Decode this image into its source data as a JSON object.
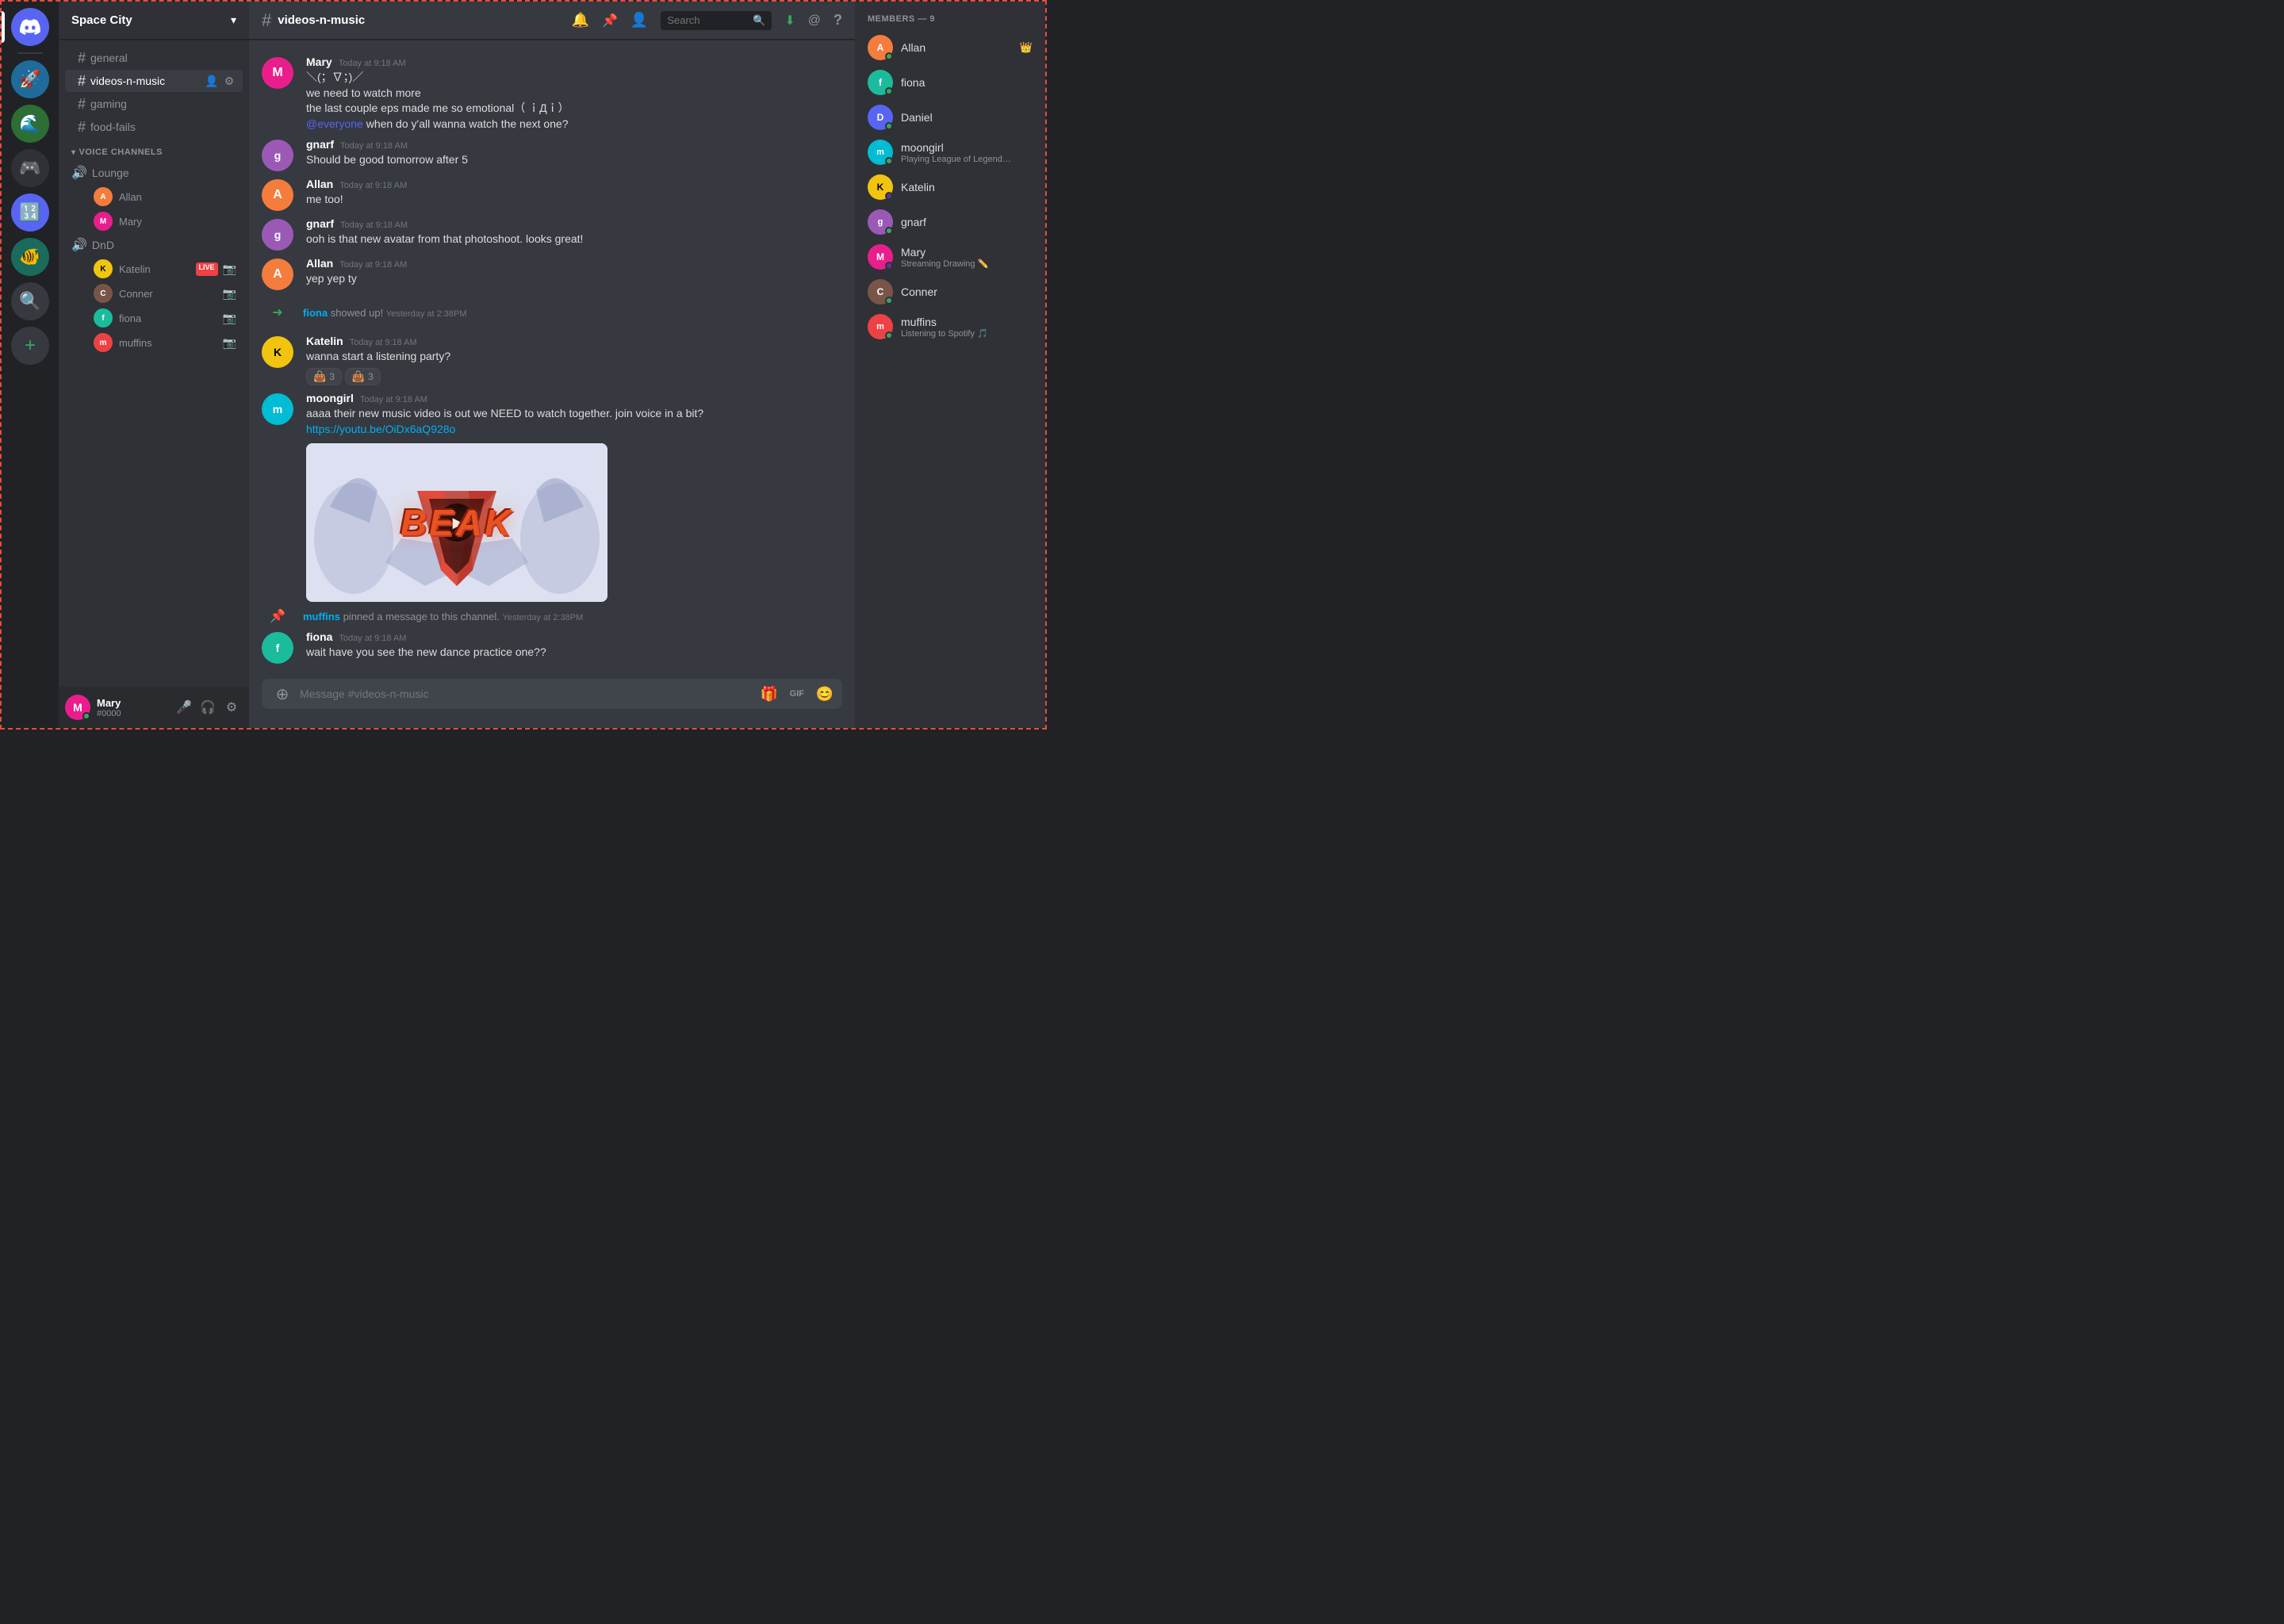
{
  "server": {
    "name": "Space City",
    "dropdown_aria": "Server dropdown"
  },
  "sidebar": {
    "channels": [
      {
        "id": "general",
        "name": "general",
        "active": false
      },
      {
        "id": "videos-n-music",
        "name": "videos-n-music",
        "active": true
      },
      {
        "id": "gaming",
        "name": "gaming",
        "active": false
      },
      {
        "id": "food-fails",
        "name": "food-fails",
        "active": false
      }
    ],
    "voice_section_label": "VOICE CHANNELS",
    "voice_channels": [
      {
        "name": "Lounge",
        "users": [
          {
            "name": "Allan",
            "avatar_color": "av-orange"
          },
          {
            "name": "Mary",
            "avatar_color": "av-pink"
          }
        ]
      },
      {
        "name": "DnD",
        "users": [
          {
            "name": "Katelin",
            "avatar_color": "av-yellow",
            "live": true
          },
          {
            "name": "Conner",
            "avatar_color": "av-brown"
          },
          {
            "name": "fiona",
            "avatar_color": "av-teal"
          },
          {
            "name": "muffins",
            "avatar_color": "av-red"
          }
        ]
      }
    ]
  },
  "current_user": {
    "name": "Mary",
    "tag": "#0000",
    "avatar_color": "av-pink"
  },
  "channel": {
    "name": "videos-n-music"
  },
  "messages": [
    {
      "id": "msg1",
      "author": "Mary",
      "avatar_color": "av-pink",
      "time": "Today at 9:18 AM",
      "lines": [
        "＼(；∇；)／",
        "we need to watch more",
        "the last couple eps made me so emotional（ ｉДｉ）",
        "@everyone when do y'all wanna watch the next one?"
      ],
      "has_everyone": true
    },
    {
      "id": "msg2",
      "author": "gnarf",
      "avatar_color": "av-purple",
      "time": "Today at 9:18 AM",
      "lines": [
        "Should be good tomorrow after 5"
      ]
    },
    {
      "id": "msg3",
      "author": "Allan",
      "avatar_color": "av-orange",
      "time": "Today at 9:18 AM",
      "lines": [
        "me too!"
      ]
    },
    {
      "id": "msg4",
      "author": "gnarf",
      "avatar_color": "av-purple",
      "time": "Today at 9:18 AM",
      "lines": [
        "ooh is that new avatar from that photoshoot. looks great!"
      ]
    },
    {
      "id": "msg5",
      "author": "Allan",
      "avatar_color": "av-orange",
      "time": "Today at 9:18 AM",
      "lines": [
        "yep yep ty"
      ]
    },
    {
      "id": "sys1",
      "type": "system_join",
      "user": "fiona",
      "text": "showed up!",
      "time": "Yesterday at 2:38PM"
    },
    {
      "id": "msg6",
      "author": "Katelin",
      "avatar_color": "av-yellow",
      "time": "Today at 9:18 AM",
      "lines": [
        "wanna start a listening party?"
      ],
      "reactions": [
        {
          "emoji": "👜",
          "count": "3"
        },
        {
          "emoji": "👜",
          "count": "3"
        }
      ]
    },
    {
      "id": "msg7",
      "author": "moongirl",
      "avatar_color": "av-cyan",
      "time": "Today at 9:18 AM",
      "lines": [
        "aaaa their new music video is out we NEED to watch together. join voice in a bit?"
      ],
      "link": "https://youtu.be/OiDx6aQ928o",
      "has_video": true,
      "video_title": "BEAK"
    },
    {
      "id": "sys2",
      "type": "system_pin",
      "user": "muffins",
      "text": "pinned a message to this channel.",
      "time": "Yesterday at 2:38PM"
    },
    {
      "id": "msg8",
      "author": "fiona",
      "avatar_color": "av-teal",
      "time": "Today at 9:18 AM",
      "lines": [
        "wait have you see the new dance practice one??"
      ]
    }
  ],
  "message_input": {
    "placeholder": "Message #videos-n-music"
  },
  "members": {
    "header": "MEMBERS — 9",
    "list": [
      {
        "name": "Allan",
        "avatar_color": "av-orange",
        "crown": true,
        "status": "online"
      },
      {
        "name": "fiona",
        "avatar_color": "av-teal",
        "status": "online"
      },
      {
        "name": "Daniel",
        "avatar_color": "av-blue",
        "status": "online"
      },
      {
        "name": "moongirl",
        "avatar_color": "av-cyan",
        "status": "online",
        "sub_status": "Playing League of Legends"
      },
      {
        "name": "Katelin",
        "avatar_color": "av-yellow",
        "status": "streaming"
      },
      {
        "name": "gnarf",
        "avatar_color": "av-purple",
        "status": "online"
      },
      {
        "name": "Mary",
        "avatar_color": "av-pink",
        "status": "streaming",
        "sub_status": "Streaming Drawing ✏️"
      },
      {
        "name": "Conner",
        "avatar_color": "av-brown",
        "status": "online"
      },
      {
        "name": "muffins",
        "avatar_color": "av-red",
        "status": "online",
        "sub_status": "Listening to Spotify"
      }
    ]
  },
  "header": {
    "search_placeholder": "Search",
    "bell_icon": "🔔",
    "pin_icon": "📌",
    "people_icon": "👥"
  },
  "discord_icon": "discord",
  "server_icons": [
    {
      "id": "s1",
      "color": "#5865f2",
      "label": "D",
      "type": "discord"
    },
    {
      "id": "s2",
      "color": "#1e6b9c",
      "label": "🚀",
      "type": "server"
    },
    {
      "id": "s3",
      "color": "#2c6e34",
      "label": "🌊",
      "type": "server"
    },
    {
      "id": "s4",
      "color": "#2f3136",
      "label": "🎮",
      "type": "server"
    },
    {
      "id": "s5",
      "color": "#5865f2",
      "label": "🔢",
      "type": "server"
    },
    {
      "id": "s6",
      "color": "#1a6b5c",
      "label": "🐠",
      "type": "server"
    },
    {
      "id": "s7",
      "color": "#36393f",
      "label": "🔍",
      "type": "server"
    }
  ]
}
